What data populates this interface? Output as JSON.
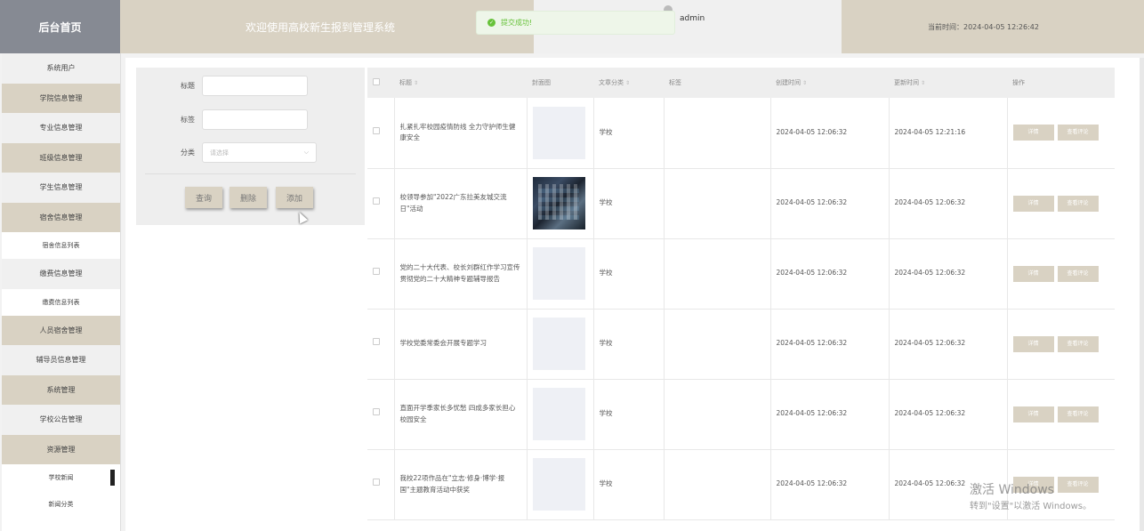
{
  "header": {
    "logo": "后台首页",
    "welcome": "欢迎使用高校新生报到管理系统",
    "user": "admin",
    "time": "当前时间：2024-04-05 12:26:42"
  },
  "toast": {
    "message": "提交成功!"
  },
  "sidebar": {
    "items": [
      {
        "label": "系统用户",
        "style": "plain"
      },
      {
        "label": "学院信息管理",
        "style": "tan"
      },
      {
        "label": "专业信息管理",
        "style": "plain"
      },
      {
        "label": "班级信息管理",
        "style": "tan"
      },
      {
        "label": "学生信息管理",
        "style": "plain"
      },
      {
        "label": "宿舍信息管理",
        "style": "tan"
      },
      {
        "label": "宿舍信息列表",
        "style": "sub"
      },
      {
        "label": "缴费信息管理",
        "style": "plain"
      },
      {
        "label": "缴费信息列表",
        "style": "sub"
      },
      {
        "label": "人员宿舍管理",
        "style": "tan"
      },
      {
        "label": "辅导员信息管理",
        "style": "plain"
      },
      {
        "label": "系统管理",
        "style": "tan"
      },
      {
        "label": "学校公告管理",
        "style": "plain"
      },
      {
        "label": "资源管理",
        "style": "tan"
      },
      {
        "label": "学校新闻",
        "style": "sub-active"
      },
      {
        "label": "新闻分类",
        "style": "sub"
      }
    ]
  },
  "form": {
    "title_label": "标题",
    "tags_label": "标签",
    "category_label": "分类",
    "category_placeholder": "请选择",
    "query_btn": "查询",
    "delete_btn": "删除",
    "add_btn": "添加"
  },
  "table": {
    "headers": {
      "title": "标题",
      "cover": "封面图",
      "category": "文章分类",
      "tags": "标签",
      "created": "创建时间",
      "updated": "更新时间",
      "actions": "操作"
    },
    "detail_btn": "详情",
    "comment_btn": "查看评论",
    "rows": [
      {
        "title": "扎紧扎牢校园疫情防线 全力守护师生健康安全",
        "cover": "blank",
        "category": "学校",
        "tags": "",
        "created": "2024-04-05 12:06:32",
        "updated": "2024-04-05 12:21:16"
      },
      {
        "title": "校领导参加\"2022广东拉美友城交流日\"活动",
        "cover": "photo",
        "category": "学校",
        "tags": "",
        "created": "2024-04-05 12:06:32",
        "updated": "2024-04-05 12:06:32"
      },
      {
        "title": "党的二十大代表、校长刘群红作学习宣传贯彻党的二十大精神专题辅导报告",
        "cover": "blank",
        "category": "学校",
        "tags": "",
        "created": "2024-04-05 12:06:32",
        "updated": "2024-04-05 12:06:32"
      },
      {
        "title": "学校党委常委会开展专题学习",
        "cover": "blank",
        "category": "学校",
        "tags": "",
        "created": "2024-04-05 12:06:32",
        "updated": "2024-04-05 12:06:32"
      },
      {
        "title": "直面开学季家长多忧愁 四成多家长担心校园安全",
        "cover": "blank",
        "category": "学校",
        "tags": "",
        "created": "2024-04-05 12:06:32",
        "updated": "2024-04-05 12:06:32"
      },
      {
        "title": "我校22项作品在\"立志·修身·博学·报国\"主题教育活动中获奖",
        "cover": "blank",
        "category": "学校",
        "tags": "",
        "created": "2024-04-05 12:06:32",
        "updated": "2024-04-05 12:06:32"
      }
    ]
  },
  "watermark": {
    "line1": "激活 Windows",
    "line2": "转到\"设置\"以激活 Windows。"
  }
}
